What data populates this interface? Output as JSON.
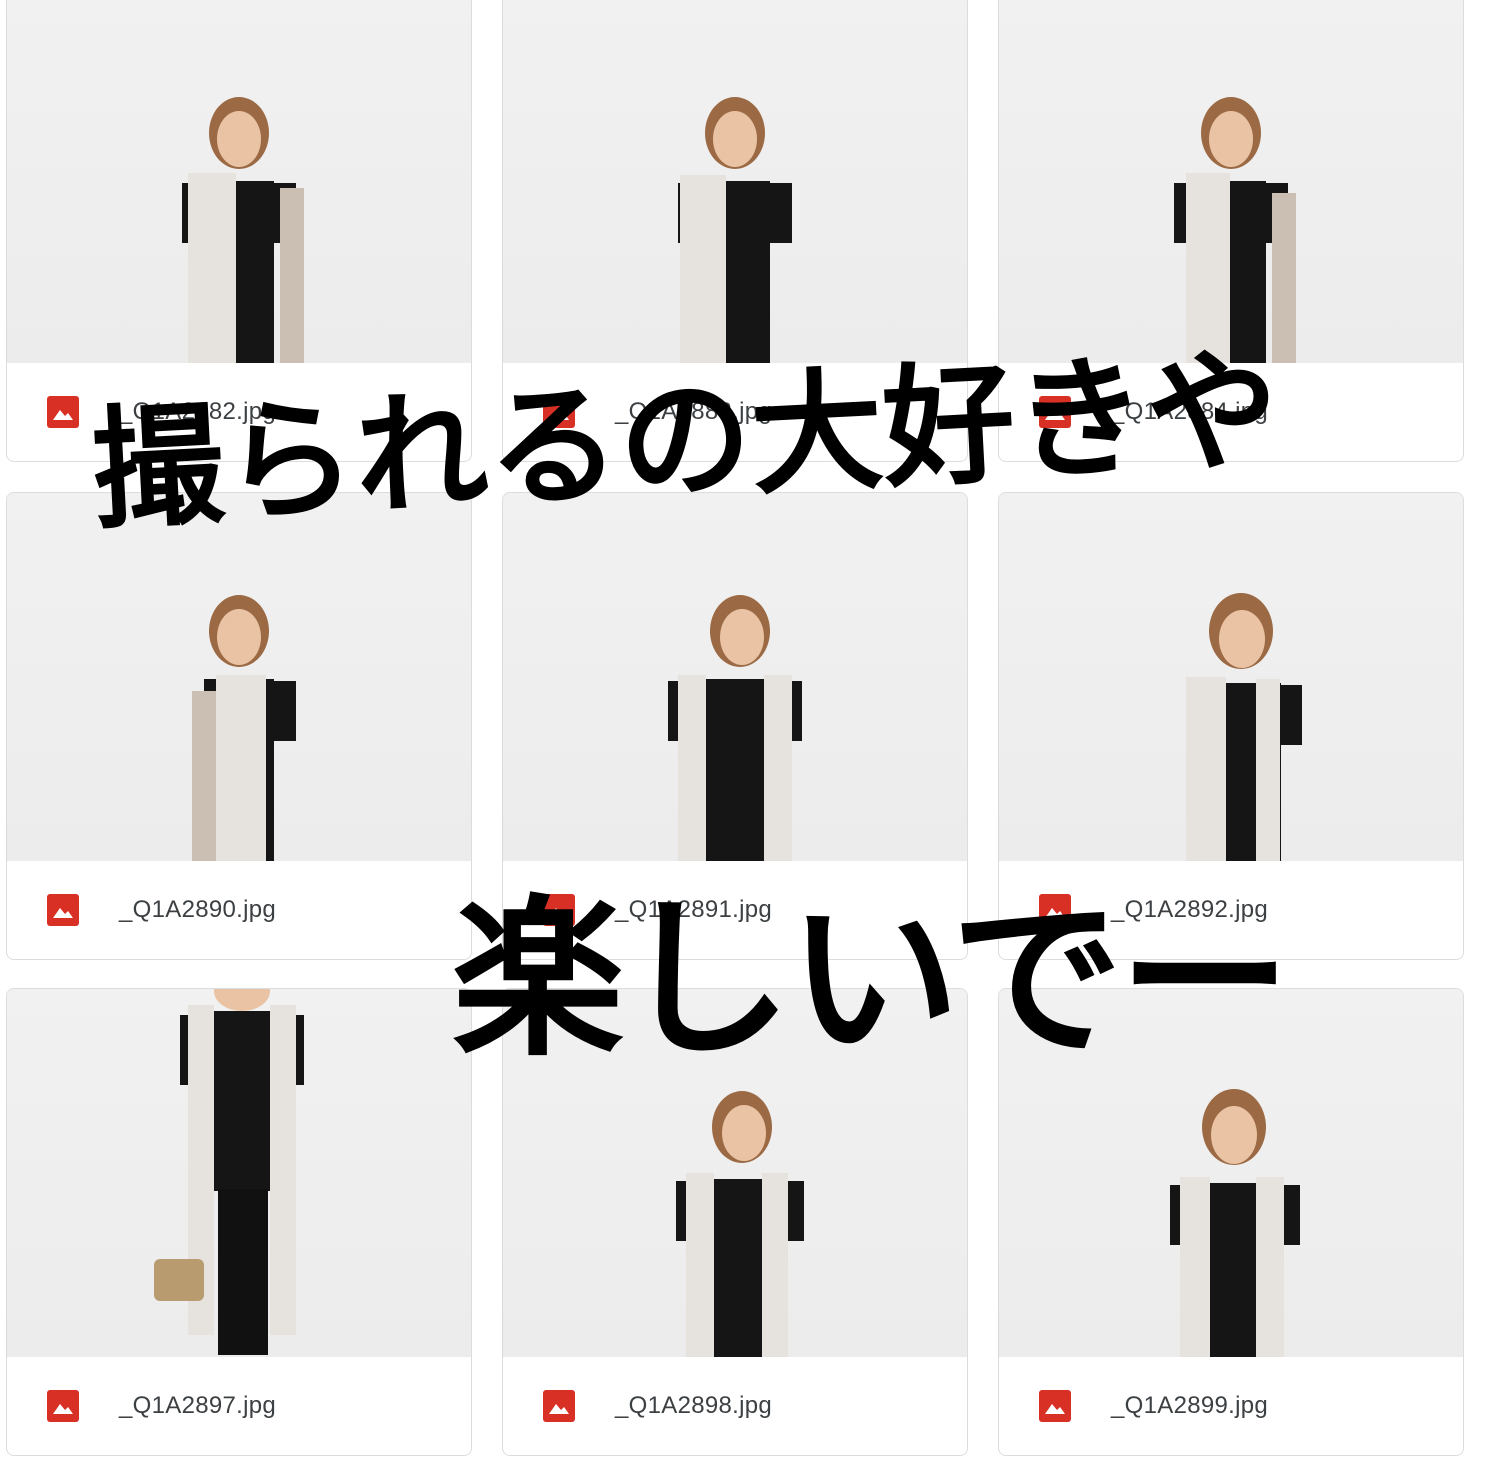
{
  "files": [
    {
      "name": "_Q1A2882.jpg",
      "icon": "image-file-icon"
    },
    {
      "name": "_Q1A2883.jpg",
      "icon": "image-file-icon"
    },
    {
      "name": "_Q1A2884.jpg",
      "icon": "image-file-icon"
    },
    {
      "name": "_Q1A2890.jpg",
      "icon": "image-file-icon"
    },
    {
      "name": "_Q1A2891.jpg",
      "icon": "image-file-icon"
    },
    {
      "name": "_Q1A2892.jpg",
      "icon": "image-file-icon"
    },
    {
      "name": "_Q1A2897.jpg",
      "icon": "image-file-icon"
    },
    {
      "name": "_Q1A2898.jpg",
      "icon": "image-file-icon"
    },
    {
      "name": "_Q1A2899.jpg",
      "icon": "image-file-icon"
    }
  ],
  "overlay": {
    "line1": "撮られるの大好きや",
    "line2": "楽しいでー"
  },
  "colors": {
    "icon_red": "#d93025",
    "border": "#dadce0",
    "filename_text": "#3c4043",
    "overlay_text": "#000000"
  }
}
